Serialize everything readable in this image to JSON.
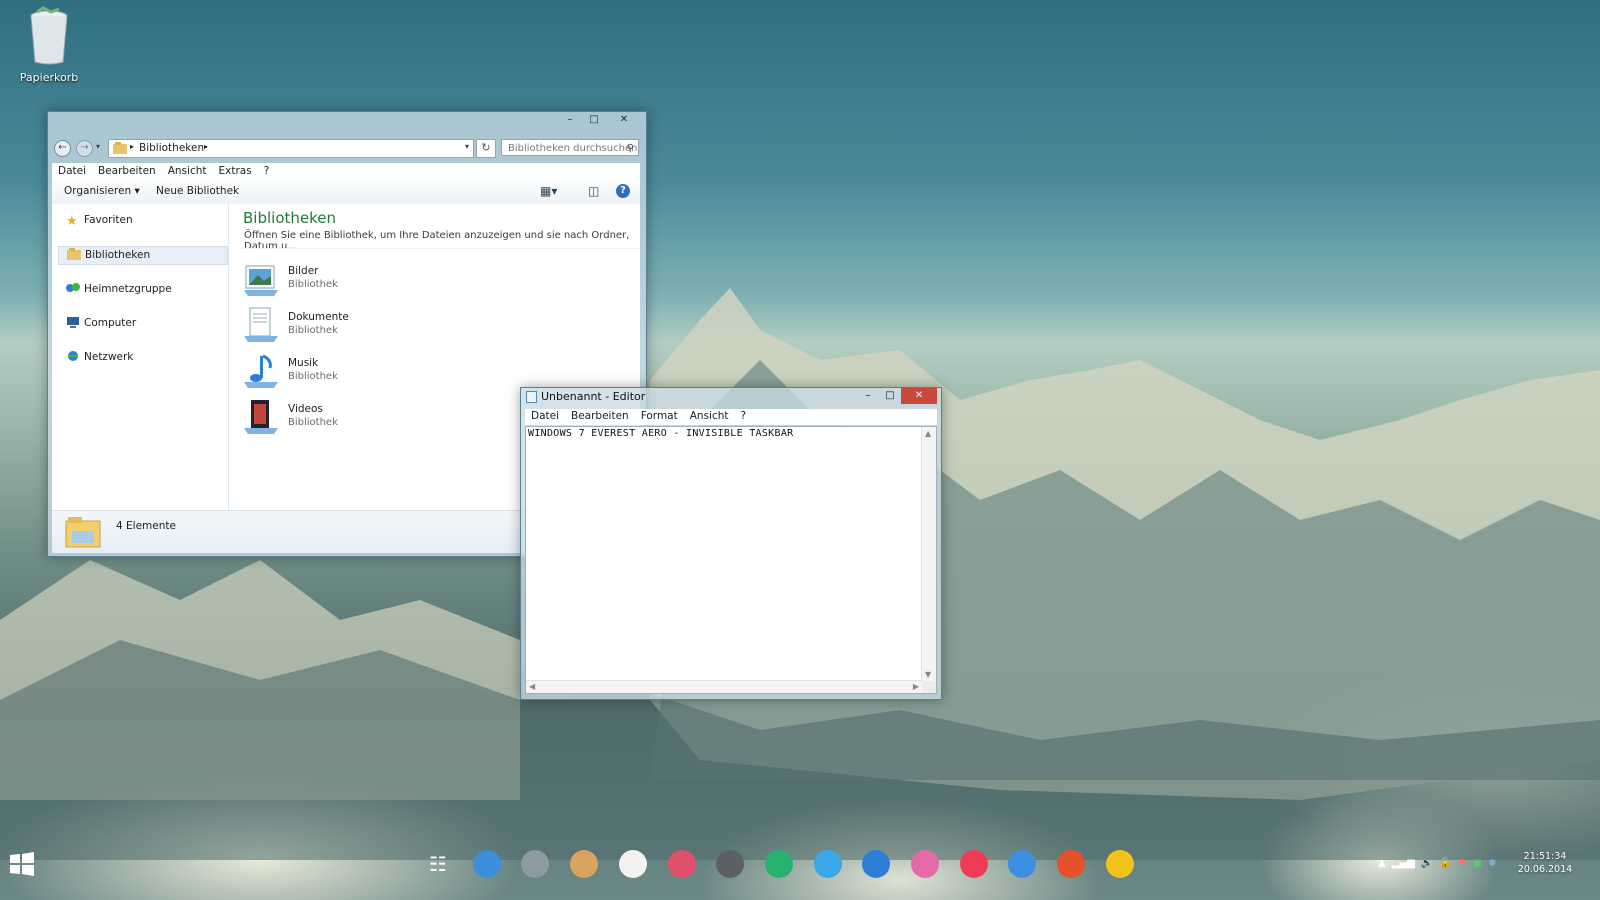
{
  "desktop": {
    "icons": [
      {
        "label": "Papierkorb",
        "icon": "recycle-bin-icon"
      }
    ]
  },
  "explorer": {
    "window_buttons": {
      "minimize": "–",
      "maximize": "□",
      "close": "✕"
    },
    "address": {
      "path_segment": "Bibliotheken"
    },
    "search": {
      "placeholder": "Bibliotheken durchsuchen"
    },
    "menu": [
      "Datei",
      "Bearbeiten",
      "Ansicht",
      "Extras",
      "?"
    ],
    "toolbar": {
      "organize_label": "Organisieren ▾",
      "new_library_label": "Neue Bibliothek"
    },
    "nav": [
      {
        "label": "Favoriten",
        "icon": "star-icon",
        "selected": false
      },
      {
        "label": "Bibliotheken",
        "icon": "library-folder-icon",
        "selected": true
      },
      {
        "label": "Heimnetzgruppe",
        "icon": "homegroup-icon",
        "selected": false
      },
      {
        "label": "Computer",
        "icon": "computer-icon",
        "selected": false
      },
      {
        "label": "Netzwerk",
        "icon": "network-icon",
        "selected": false
      }
    ],
    "content": {
      "title": "Bibliotheken",
      "description": "Öffnen Sie eine Bibliothek, um Ihre Dateien anzuzeigen und sie nach Ordner, Datum u...",
      "libraries": [
        {
          "name": "Bilder",
          "type": "Bibliothek",
          "icon": "pictures-library-icon"
        },
        {
          "name": "Dokumente",
          "type": "Bibliothek",
          "icon": "documents-library-icon"
        },
        {
          "name": "Musik",
          "type": "Bibliothek",
          "icon": "music-library-icon"
        },
        {
          "name": "Videos",
          "type": "Bibliothek",
          "icon": "videos-library-icon"
        }
      ]
    },
    "status": {
      "count": "4 Elemente"
    }
  },
  "notepad": {
    "title": "Unbenannt - Editor",
    "menu": [
      "Datei",
      "Bearbeiten",
      "Format",
      "Ansicht",
      "?"
    ],
    "text": "WINDOWS 7 EVEREST AERO - INVISIBLE TASKBAR"
  },
  "taskbar": {
    "dock": [
      {
        "name": "launchpad-grid-icon",
        "color": "#ffffff"
      },
      {
        "name": "finder-icon",
        "color": "#3b8fdc"
      },
      {
        "name": "rocket-launcher-icon",
        "color": "#8e9aa3"
      },
      {
        "name": "notebook-icon",
        "color": "#d9a45e"
      },
      {
        "name": "documents-icon",
        "color": "#f2f2f2"
      },
      {
        "name": "paint-icon",
        "color": "#e0506a"
      },
      {
        "name": "system-preferences-icon",
        "color": "#5c5f63"
      },
      {
        "name": "podcast-icon",
        "color": "#27b36f"
      },
      {
        "name": "messages-icon",
        "color": "#3aa8e8"
      },
      {
        "name": "info-icon",
        "color": "#2c7fd6"
      },
      {
        "name": "color-picker-icon",
        "color": "#e36aa6"
      },
      {
        "name": "itunes-icon",
        "color": "#ef3b56"
      },
      {
        "name": "icloud-icon",
        "color": "#3d8fe0"
      },
      {
        "name": "office-icon",
        "color": "#e5512a"
      },
      {
        "name": "chrome-icon",
        "color": "#f2c31b"
      }
    ],
    "clock": {
      "time": "21:51:34",
      "date": "20.06.2014"
    }
  }
}
